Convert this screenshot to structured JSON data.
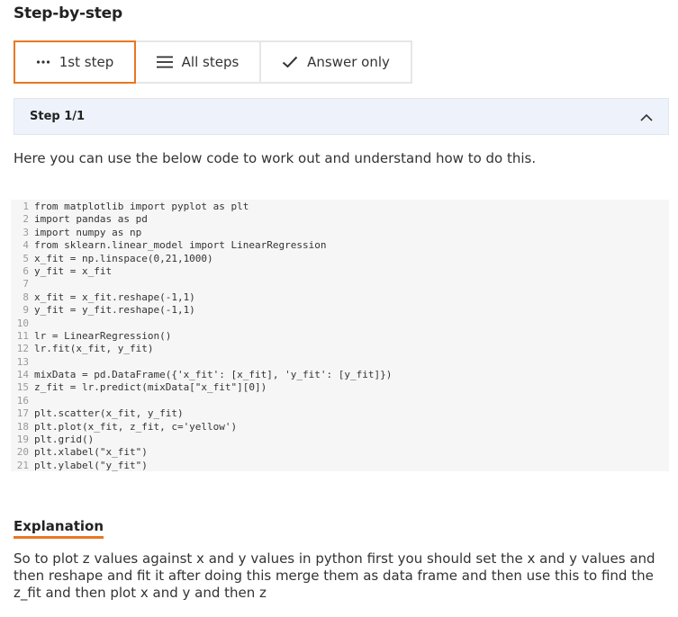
{
  "heading": "Step-by-step",
  "tabs": [
    {
      "label": "1st step",
      "icon": "dots-icon",
      "active": true
    },
    {
      "label": "All steps",
      "icon": "list-icon",
      "active": false
    },
    {
      "label": "Answer only",
      "icon": "check-icon",
      "active": false
    }
  ],
  "step": {
    "label": "Step 1/1",
    "toggle_icon": "chevron-up-icon"
  },
  "intro": "Here you can use the below code to work out and understand how to do this.",
  "code_lines": [
    {
      "num": "1",
      "text": "from matplotlib import pyplot as plt"
    },
    {
      "num": "2",
      "text": "import pandas as pd"
    },
    {
      "num": "3",
      "text": "import numpy as np"
    },
    {
      "num": "4",
      "text": "from sklearn.linear_model import LinearRegression"
    },
    {
      "num": "5",
      "text": "x_fit = np.linspace(0,21,1000)"
    },
    {
      "num": "6",
      "text": "y_fit = x_fit"
    },
    {
      "num": "7",
      "text": ""
    },
    {
      "num": "8",
      "text": "x_fit = x_fit.reshape(-1,1)"
    },
    {
      "num": "9",
      "text": "y_fit = y_fit.reshape(-1,1)"
    },
    {
      "num": "10",
      "text": ""
    },
    {
      "num": "11",
      "text": "lr = LinearRegression()"
    },
    {
      "num": "12",
      "text": "lr.fit(x_fit, y_fit)"
    },
    {
      "num": "13",
      "text": ""
    },
    {
      "num": "14",
      "text": "mixData = pd.DataFrame({'x_fit': [x_fit], 'y_fit': [y_fit]})"
    },
    {
      "num": "15",
      "text": "z_fit = lr.predict(mixData[\"x_fit\"][0])"
    },
    {
      "num": "16",
      "text": ""
    },
    {
      "num": "17",
      "text": "plt.scatter(x_fit, y_fit)"
    },
    {
      "num": "18",
      "text": "plt.plot(x_fit, z_fit, c='yellow')"
    },
    {
      "num": "19",
      "text": "plt.grid()"
    },
    {
      "num": "20",
      "text": "plt.xlabel(\"x_fit\")"
    },
    {
      "num": "21",
      "text": "plt.ylabel(\"y_fit\")"
    }
  ],
  "explanation": {
    "title": "Explanation",
    "text": "So to plot z values against x and y values in python first you should set the x and y values and then reshape and fit it after doing this merge them as data frame and then use this to find the z_fit  and then plot x and y and then z"
  },
  "colors": {
    "accent": "#e87722",
    "step_bar_bg": "#eef3fb",
    "code_bg": "#f6f6f6"
  }
}
